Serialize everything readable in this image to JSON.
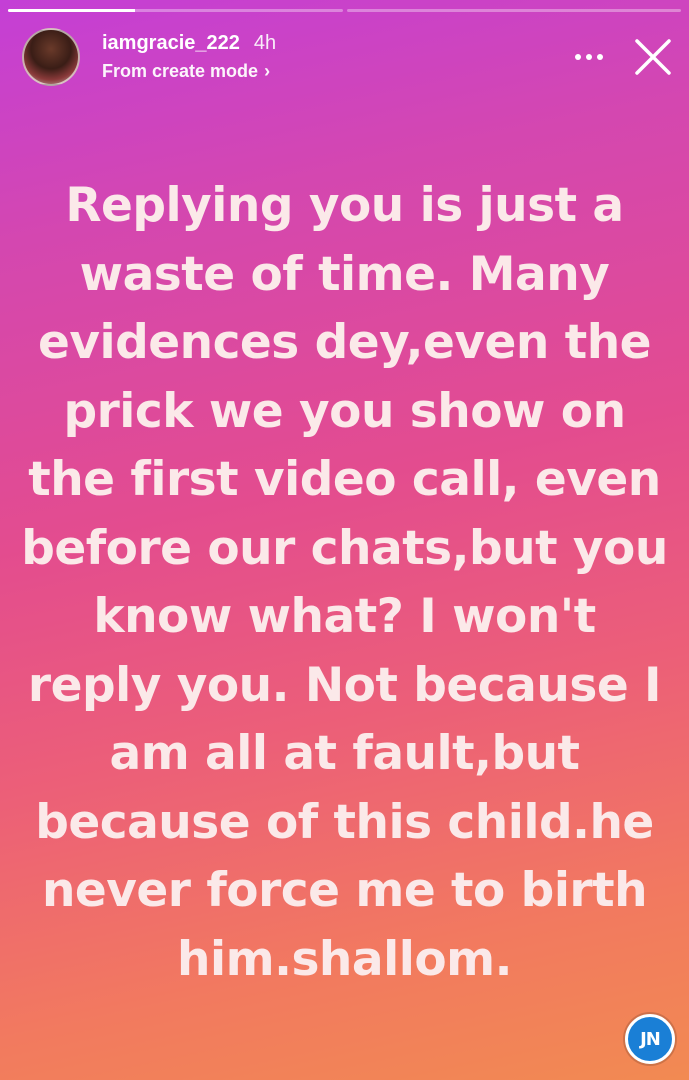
{
  "progress": {
    "segments": [
      {
        "value": 0.38
      },
      {
        "value": 0.0
      }
    ]
  },
  "header": {
    "username": "iamgracie_222",
    "time_ago": "4h",
    "subtitle": "From create mode",
    "chevron": "›"
  },
  "story": {
    "text": "Replying you is just a waste of time. Many evidences dey,even the prick we you show on the first video call, even before our chats,but you know what? I won't reply you. Not because I am all at fault,but because of this child.he never force me to birth him.shallom."
  },
  "watermark": {
    "text": "JN"
  },
  "icons": {
    "more": "more-horizontal-icon",
    "close": "close-icon",
    "avatar": "avatar"
  }
}
